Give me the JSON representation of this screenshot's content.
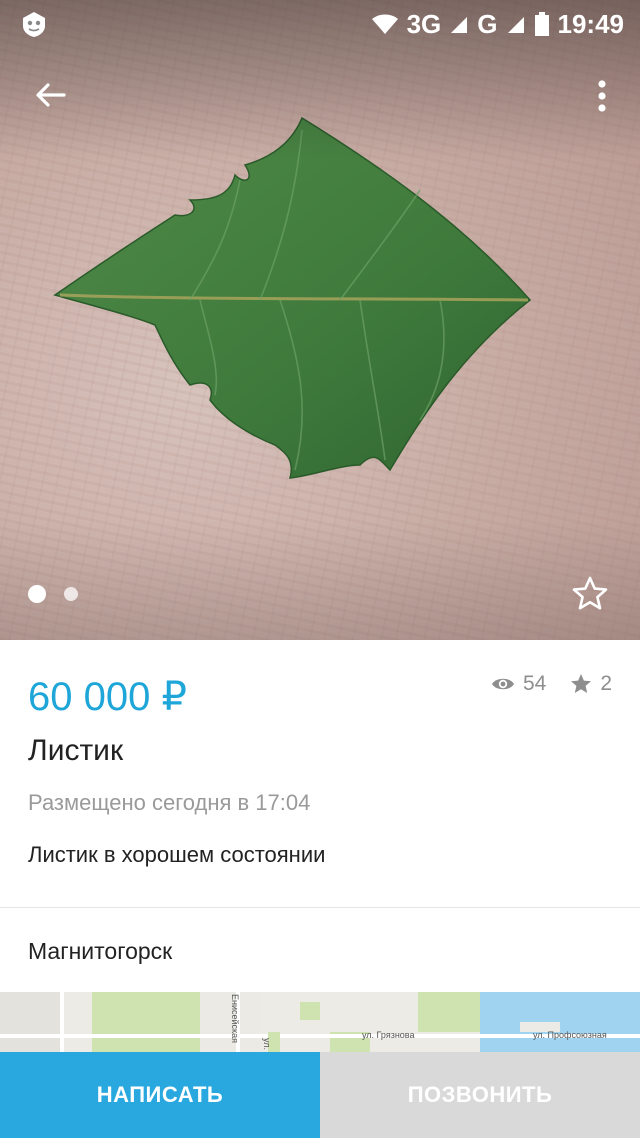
{
  "status_bar": {
    "network_3g": "3G",
    "network_g": "G",
    "time": "19:49"
  },
  "listing": {
    "price": "60 000 ₽",
    "views": "54",
    "favorites": "2",
    "title": "Листик",
    "posted": "Размещено сегодня в 17:04",
    "description": "Листик в хорошем состоянии",
    "city": "Магнитогорск"
  },
  "gallery": {
    "current_index": 1,
    "total": 2
  },
  "map": {
    "labels": [
      "Енисейская",
      "ул. Грязнова",
      "ул. Профсоюзная",
      "ул."
    ]
  },
  "actions": {
    "write_label": "НАПИСАТЬ",
    "call_label": "ПОЗВОНИТЬ"
  },
  "colors": {
    "accent": "#1ea6d9",
    "write_button": "#29a8df",
    "call_button": "#d9d9d9"
  }
}
